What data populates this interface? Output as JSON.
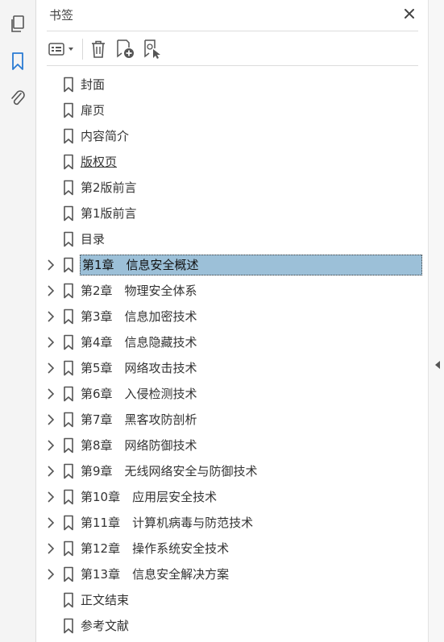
{
  "panel": {
    "title": "书签"
  },
  "rail": {
    "icons": [
      "pages-icon",
      "bookmark-icon",
      "attachment-icon"
    ]
  },
  "toolbar": {
    "buttons": [
      "options-menu",
      "delete-bookmark",
      "new-bookmark",
      "new-bookmark-from-structure"
    ]
  },
  "bookmarks": [
    {
      "label": "封面",
      "expandable": false
    },
    {
      "label": "扉页",
      "expandable": false
    },
    {
      "label": "内容简介",
      "expandable": false
    },
    {
      "label": "版权页",
      "expandable": false
    },
    {
      "label": "第2版前言",
      "expandable": false
    },
    {
      "label": "第1版前言",
      "expandable": false
    },
    {
      "label": "目录",
      "expandable": false
    },
    {
      "label": "第1章　信息安全概述",
      "expandable": true,
      "selected": true
    },
    {
      "label": "第2章　物理安全体系",
      "expandable": true
    },
    {
      "label": "第3章　信息加密技术",
      "expandable": true
    },
    {
      "label": "第4章　信息隐藏技术",
      "expandable": true
    },
    {
      "label": "第5章　网络攻击技术",
      "expandable": true
    },
    {
      "label": "第6章　入侵检测技术",
      "expandable": true
    },
    {
      "label": "第7章　黑客攻防剖析",
      "expandable": true
    },
    {
      "label": "第8章　网络防御技术",
      "expandable": true
    },
    {
      "label": "第9章　无线网络安全与防御技术",
      "expandable": true
    },
    {
      "label": "第10章　应用层安全技术",
      "expandable": true
    },
    {
      "label": "第11章　计算机病毒与防范技术",
      "expandable": true
    },
    {
      "label": "第12章　操作系统安全技术",
      "expandable": true
    },
    {
      "label": "第13章　信息安全解决方案",
      "expandable": true
    },
    {
      "label": "正文结束",
      "expandable": false
    },
    {
      "label": "参考文献",
      "expandable": false
    }
  ],
  "colors": {
    "selection": "#9cc0d8",
    "accent": "#2a7bd3"
  }
}
